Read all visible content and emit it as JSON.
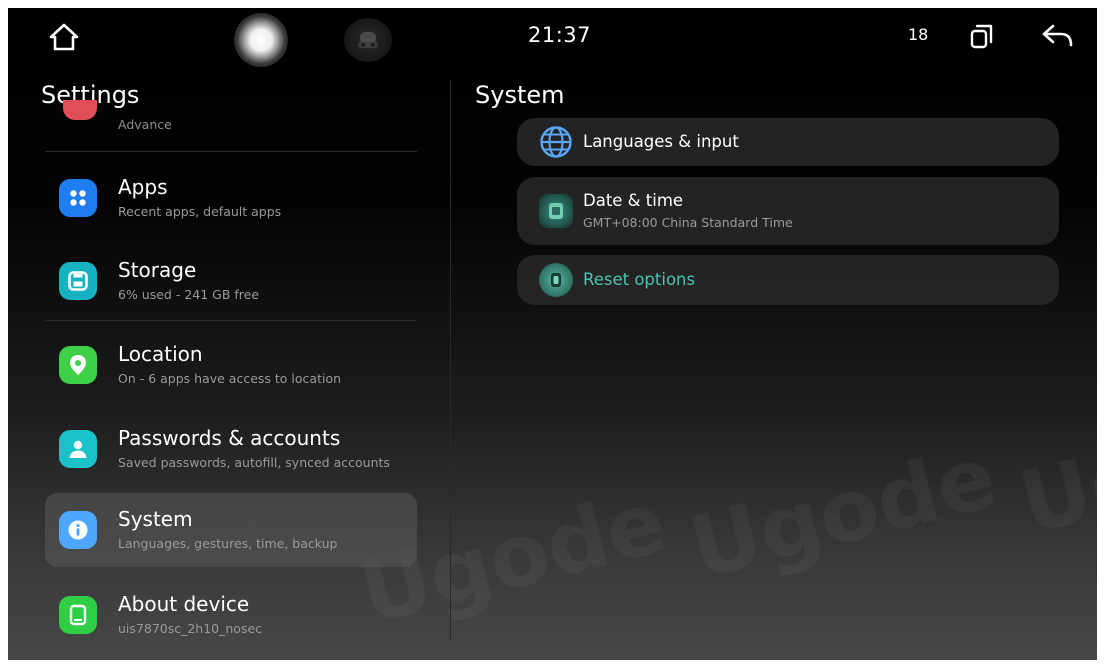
{
  "status_bar": {
    "time": "21:37",
    "count": "18"
  },
  "left_panel": {
    "title": "Settings",
    "partial_item_subtitle": "Advance",
    "items": [
      {
        "title": "Apps",
        "subtitle": "Recent apps, default apps",
        "icon": "apps-grid-icon",
        "color": "#1f7df2"
      },
      {
        "title": "Storage",
        "subtitle": "6% used - 241 GB free",
        "icon": "storage-icon",
        "color": "#17b2c2"
      },
      {
        "title": "Location",
        "subtitle": "On - 6 apps have access to location",
        "icon": "location-pin-icon",
        "color": "#3fd04a"
      },
      {
        "title": "Passwords & accounts",
        "subtitle": "Saved passwords, autofill, synced accounts",
        "icon": "account-icon",
        "color": "#19c2c9"
      },
      {
        "title": "System",
        "subtitle": "Languages, gestures, time, backup",
        "icon": "info-icon",
        "color": "#4da7ff",
        "selected": true
      },
      {
        "title": "About device",
        "subtitle": "uis7870sc_2h10_nosec",
        "icon": "phone-icon",
        "color": "#2fcf45"
      }
    ]
  },
  "right_panel": {
    "title": "System",
    "items": [
      {
        "title": "Languages & input",
        "subtitle": "",
        "icon": "globe-icon"
      },
      {
        "title": "Date & time",
        "subtitle": "GMT+08:00 China Standard Time",
        "icon": "date-time-icon"
      },
      {
        "title": "Reset options",
        "subtitle": "",
        "icon": "reset-icon",
        "title_color": "#49c4b5"
      }
    ]
  },
  "watermark": "Ugode"
}
